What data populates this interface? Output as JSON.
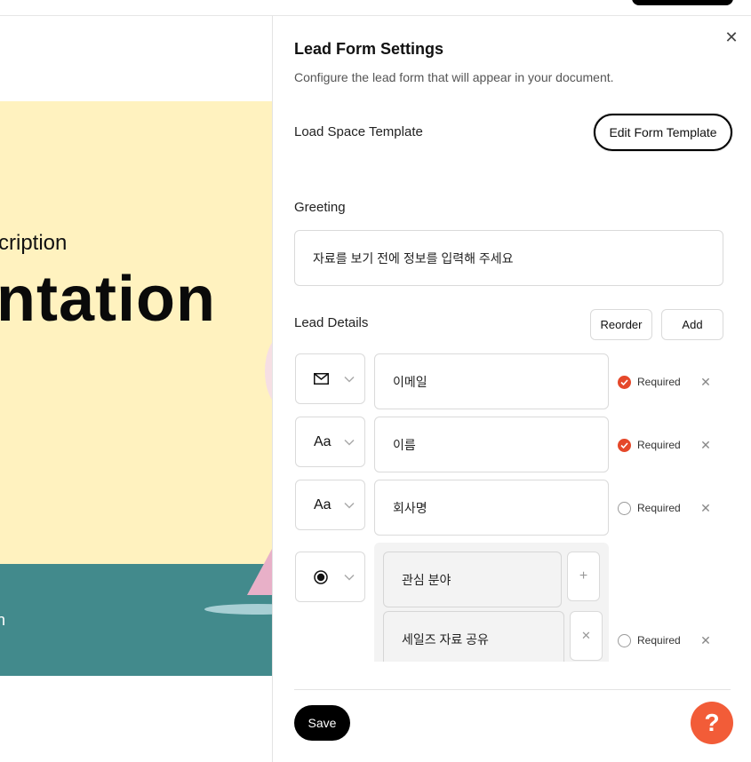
{
  "background": {
    "slide_subtitle": "cription",
    "slide_title": "ntation",
    "slide_footer_text": "n"
  },
  "panel": {
    "title": "Lead Form Settings",
    "subtitle": "Configure the lead form that will appear in your document.",
    "template_label": "Load Space Template",
    "edit_template_label": "Edit Form Template",
    "greeting_label": "Greeting",
    "greeting_value": "자료를 보기 전에 정보를 입력해 주세요",
    "lead_details_label": "Lead Details",
    "reorder_label": "Reorder",
    "add_label": "Add",
    "fields": [
      {
        "type_icon": "mail-icon",
        "type_glyph": "",
        "value": "이메일",
        "required_label": "Required",
        "required": true
      },
      {
        "type_icon": "text-type-icon",
        "type_glyph": "Aa",
        "value": "이름",
        "required_label": "Required",
        "required": true
      },
      {
        "type_icon": "text-type-icon",
        "type_glyph": "Aa",
        "value": "회사명",
        "required_label": "Required",
        "required": false
      },
      {
        "type_icon": "radio-type-icon",
        "type_glyph": "",
        "options": [
          "관심 분야",
          "세일즈 자료 공유"
        ],
        "required_label": "Required",
        "required": false
      }
    ],
    "save_label": "Save"
  },
  "help": {
    "label": "?"
  },
  "colors": {
    "accent": "#f25c38",
    "required_checked": "#e5482a",
    "slide_yellow": "#fff2bf",
    "slide_teal": "#428a8c"
  }
}
